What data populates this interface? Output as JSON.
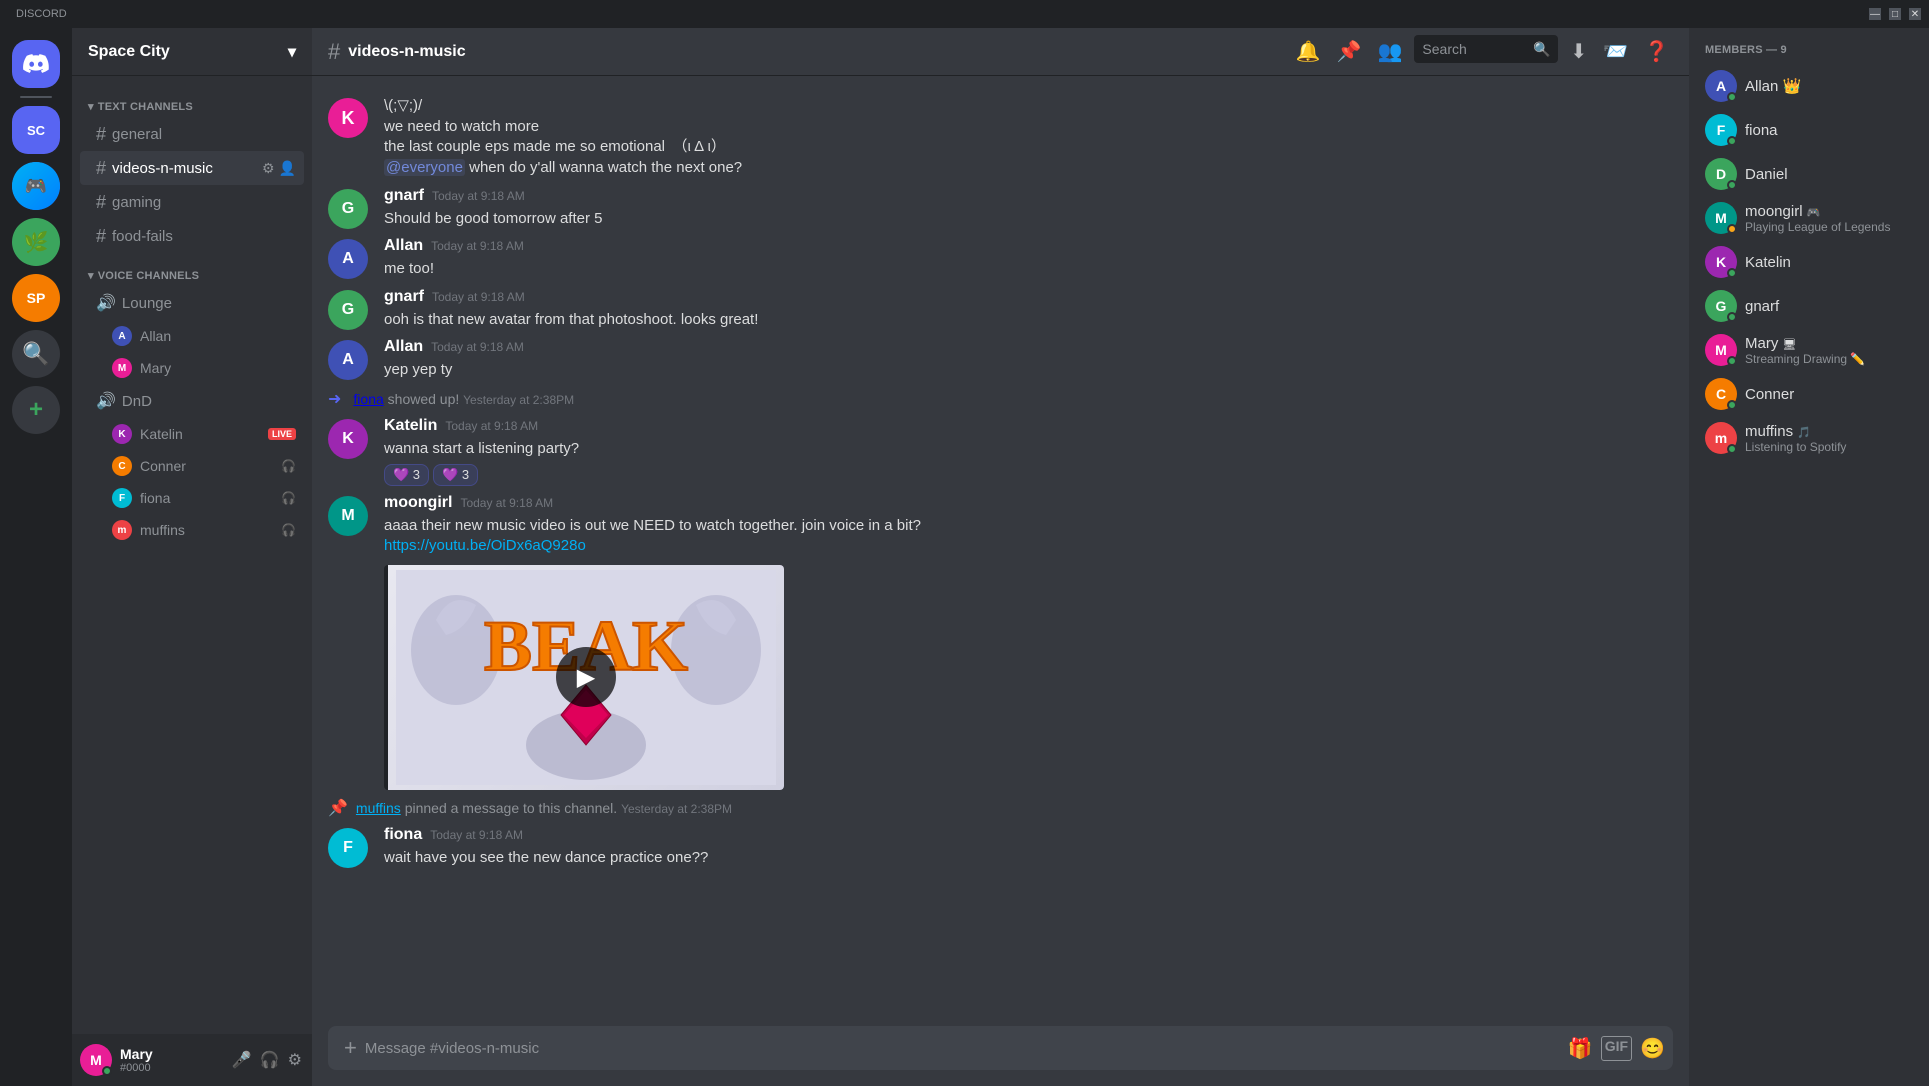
{
  "titlebar": {
    "minimize": "—",
    "maximize": "□",
    "close": "✕"
  },
  "app": {
    "name": "Discord"
  },
  "server": {
    "name": "Space City",
    "member_count": 9
  },
  "channel": {
    "name": "videos-n-music",
    "category_text_header": "Text Channels",
    "category_voice_header": "Voice Channels"
  },
  "text_channels": [
    {
      "name": "general",
      "active": false
    },
    {
      "name": "videos-n-music",
      "active": true
    },
    {
      "name": "gaming",
      "active": false
    },
    {
      "name": "food-fails",
      "active": false
    }
  ],
  "voice_channels": [
    {
      "name": "Lounge",
      "members": [
        {
          "name": "Allan",
          "live": false
        },
        {
          "name": "Mary",
          "live": false
        }
      ]
    },
    {
      "name": "DnD",
      "members": [
        {
          "name": "Katelin",
          "live": true
        },
        {
          "name": "Conner",
          "live": false
        },
        {
          "name": "fiona",
          "live": false
        },
        {
          "name": "muffins",
          "live": false
        }
      ]
    }
  ],
  "messages": [
    {
      "id": "msg1",
      "author": "prev_user",
      "text_lines": [
        "\\(;▽;)/",
        "we need to watch more",
        "the last couple eps made me so emotional　（ι Δ ι）",
        "@everyone when do y'all wanna watch the next one?"
      ],
      "avatar_color": "av-pink",
      "avatar_letter": "K"
    },
    {
      "id": "msg2",
      "author": "gnarf",
      "timestamp": "Today at 9:18 AM",
      "text": "Should be good tomorrow after 5",
      "avatar_color": "av-green",
      "avatar_letter": "G"
    },
    {
      "id": "msg3",
      "author": "Allan",
      "timestamp": "Today at 9:18 AM",
      "text": "me too!",
      "avatar_color": "av-indigo",
      "avatar_letter": "A"
    },
    {
      "id": "msg4",
      "author": "gnarf",
      "timestamp": "Today at 9:18 AM",
      "text": "ooh is that new avatar from that photoshoot. looks great!",
      "avatar_color": "av-green",
      "avatar_letter": "G"
    },
    {
      "id": "msg5",
      "author": "Allan",
      "timestamp": "Today at 9:18 AM",
      "text": "yep yep ty",
      "avatar_color": "av-indigo",
      "avatar_letter": "A"
    },
    {
      "id": "sys1",
      "type": "system",
      "text": "fiona showed up!",
      "timestamp": "Yesterday at 2:38PM"
    },
    {
      "id": "msg6",
      "author": "Katelin",
      "timestamp": "Today at 9:18 AM",
      "text": "wanna start a listening party?",
      "reactions": [
        {
          "emoji": "💜",
          "count": 3
        },
        {
          "emoji": "💜",
          "count": 3
        }
      ],
      "avatar_color": "av-purple",
      "avatar_letter": "K"
    },
    {
      "id": "msg7",
      "author": "moongirl",
      "timestamp": "Today at 9:18 AM",
      "text": "aaaa their new music video is out we NEED to watch together. join voice in a bit?",
      "link": "https://youtu.be/OiDx6aQ928o",
      "has_embed": true,
      "avatar_color": "av-teal",
      "avatar_letter": "M"
    },
    {
      "id": "sys2",
      "type": "pinned",
      "user": "muffins",
      "text": "pinned a message to this channel.",
      "timestamp": "Yesterday at 2:38PM"
    },
    {
      "id": "msg8",
      "author": "fiona",
      "timestamp": "Today at 9:18 AM",
      "text": "wait have you see the new dance practice one??",
      "avatar_color": "av-cyan",
      "avatar_letter": "F"
    }
  ],
  "members": [
    {
      "name": "Allan",
      "status": "online",
      "badge": "👑",
      "avatar_color": "av-indigo",
      "avatar_letter": "A"
    },
    {
      "name": "fiona",
      "status": "online",
      "avatar_color": "av-cyan",
      "avatar_letter": "F"
    },
    {
      "name": "Daniel",
      "status": "online",
      "avatar_color": "av-green",
      "avatar_letter": "D"
    },
    {
      "name": "moongirl",
      "status": "idle",
      "activity": "Playing League of Legends",
      "avatar_color": "av-teal",
      "avatar_letter": "M",
      "has_icon": true
    },
    {
      "name": "Katelin",
      "status": "online",
      "avatar_color": "av-purple",
      "avatar_letter": "K"
    },
    {
      "name": "gnarf",
      "status": "online",
      "avatar_color": "av-green",
      "avatar_letter": "G"
    },
    {
      "name": "Mary",
      "status": "online",
      "activity": "Streaming Drawing",
      "avatar_color": "av-pink",
      "avatar_letter": "M",
      "has_icon": true
    },
    {
      "name": "Conner",
      "status": "online",
      "avatar_color": "av-orange",
      "avatar_letter": "C"
    },
    {
      "name": "muffins",
      "status": "online",
      "activity": "Listening to Spotify",
      "avatar_color": "av-red",
      "avatar_letter": "m",
      "has_icon": true
    }
  ],
  "members_header": "MEMBERS — 9",
  "current_user": {
    "name": "Mary",
    "tag": "#0000",
    "avatar_color": "av-pink",
    "avatar_letter": "M"
  },
  "input_placeholder": "Message #videos-n-music",
  "search_placeholder": "Search",
  "header_icons": [
    "🔔",
    "📌",
    "👥"
  ],
  "labels": {
    "live": "LIVE"
  }
}
